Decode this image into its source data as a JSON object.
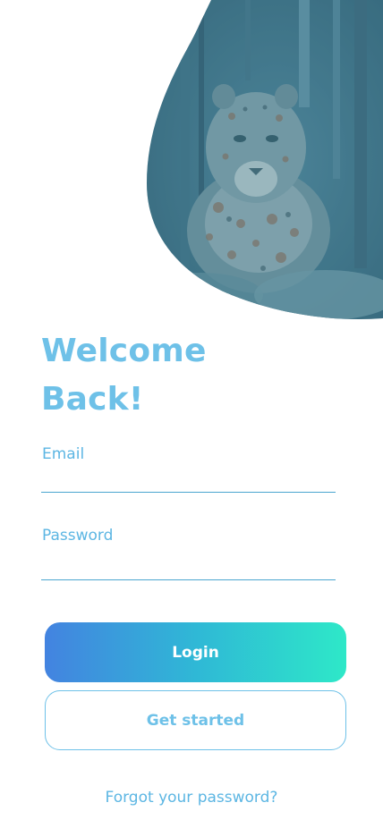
{
  "welcome": {
    "title_line1": "Welcome",
    "title_line2": "Back!"
  },
  "form": {
    "email": {
      "label": "Email",
      "value": ""
    },
    "password": {
      "label": "Password",
      "value": ""
    }
  },
  "buttons": {
    "login_label": "Login",
    "get_started_label": "Get started"
  },
  "links": {
    "forgot_password": "Forgot your password?"
  },
  "theme": {
    "accent": "#6ec1e8",
    "gradient_start": "#4383e0",
    "gradient_end": "#2ee8c8",
    "image_tint": "#4f8fa6"
  },
  "hero": {
    "image_subject": "leopard-photo"
  }
}
